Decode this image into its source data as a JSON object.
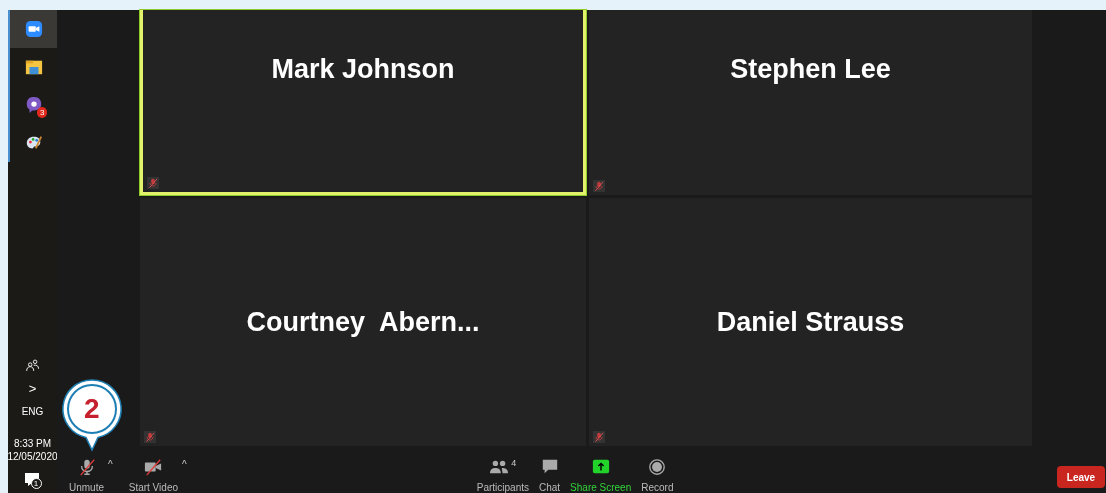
{
  "taskbar": {
    "apps": [
      {
        "kind": "zoom",
        "selected": true
      },
      {
        "kind": "folder",
        "selected": false
      },
      {
        "kind": "viber",
        "selected": false,
        "badge": "3"
      },
      {
        "kind": "paint",
        "selected": false
      }
    ],
    "tray": {
      "chevron": ">",
      "language": "ENG",
      "time": "8:33 PM",
      "date": "12/05/2020",
      "notification_count": "1"
    }
  },
  "tiles": [
    {
      "name": "Mark Johnson",
      "speaking": true,
      "muted": true
    },
    {
      "name": "Stephen Lee",
      "speaking": false,
      "muted": true
    },
    {
      "name": "Courtney  Abern...",
      "speaking": false,
      "muted": true
    },
    {
      "name": "Daniel Strauss",
      "speaking": false,
      "muted": true
    }
  ],
  "toolbar": {
    "left": [
      {
        "kind": "mic",
        "label": "Unmute",
        "off": true,
        "caret": "^"
      },
      {
        "kind": "video",
        "label": "Start Video",
        "off": true,
        "caret": "^"
      }
    ],
    "center": [
      {
        "kind": "participants",
        "label": "Participants",
        "count": "4"
      },
      {
        "kind": "chat",
        "label": "Chat"
      },
      {
        "kind": "share",
        "label": "Share Screen"
      },
      {
        "kind": "record",
        "label": "Record"
      }
    ],
    "leave": "Leave"
  },
  "callout": {
    "number": "2"
  }
}
